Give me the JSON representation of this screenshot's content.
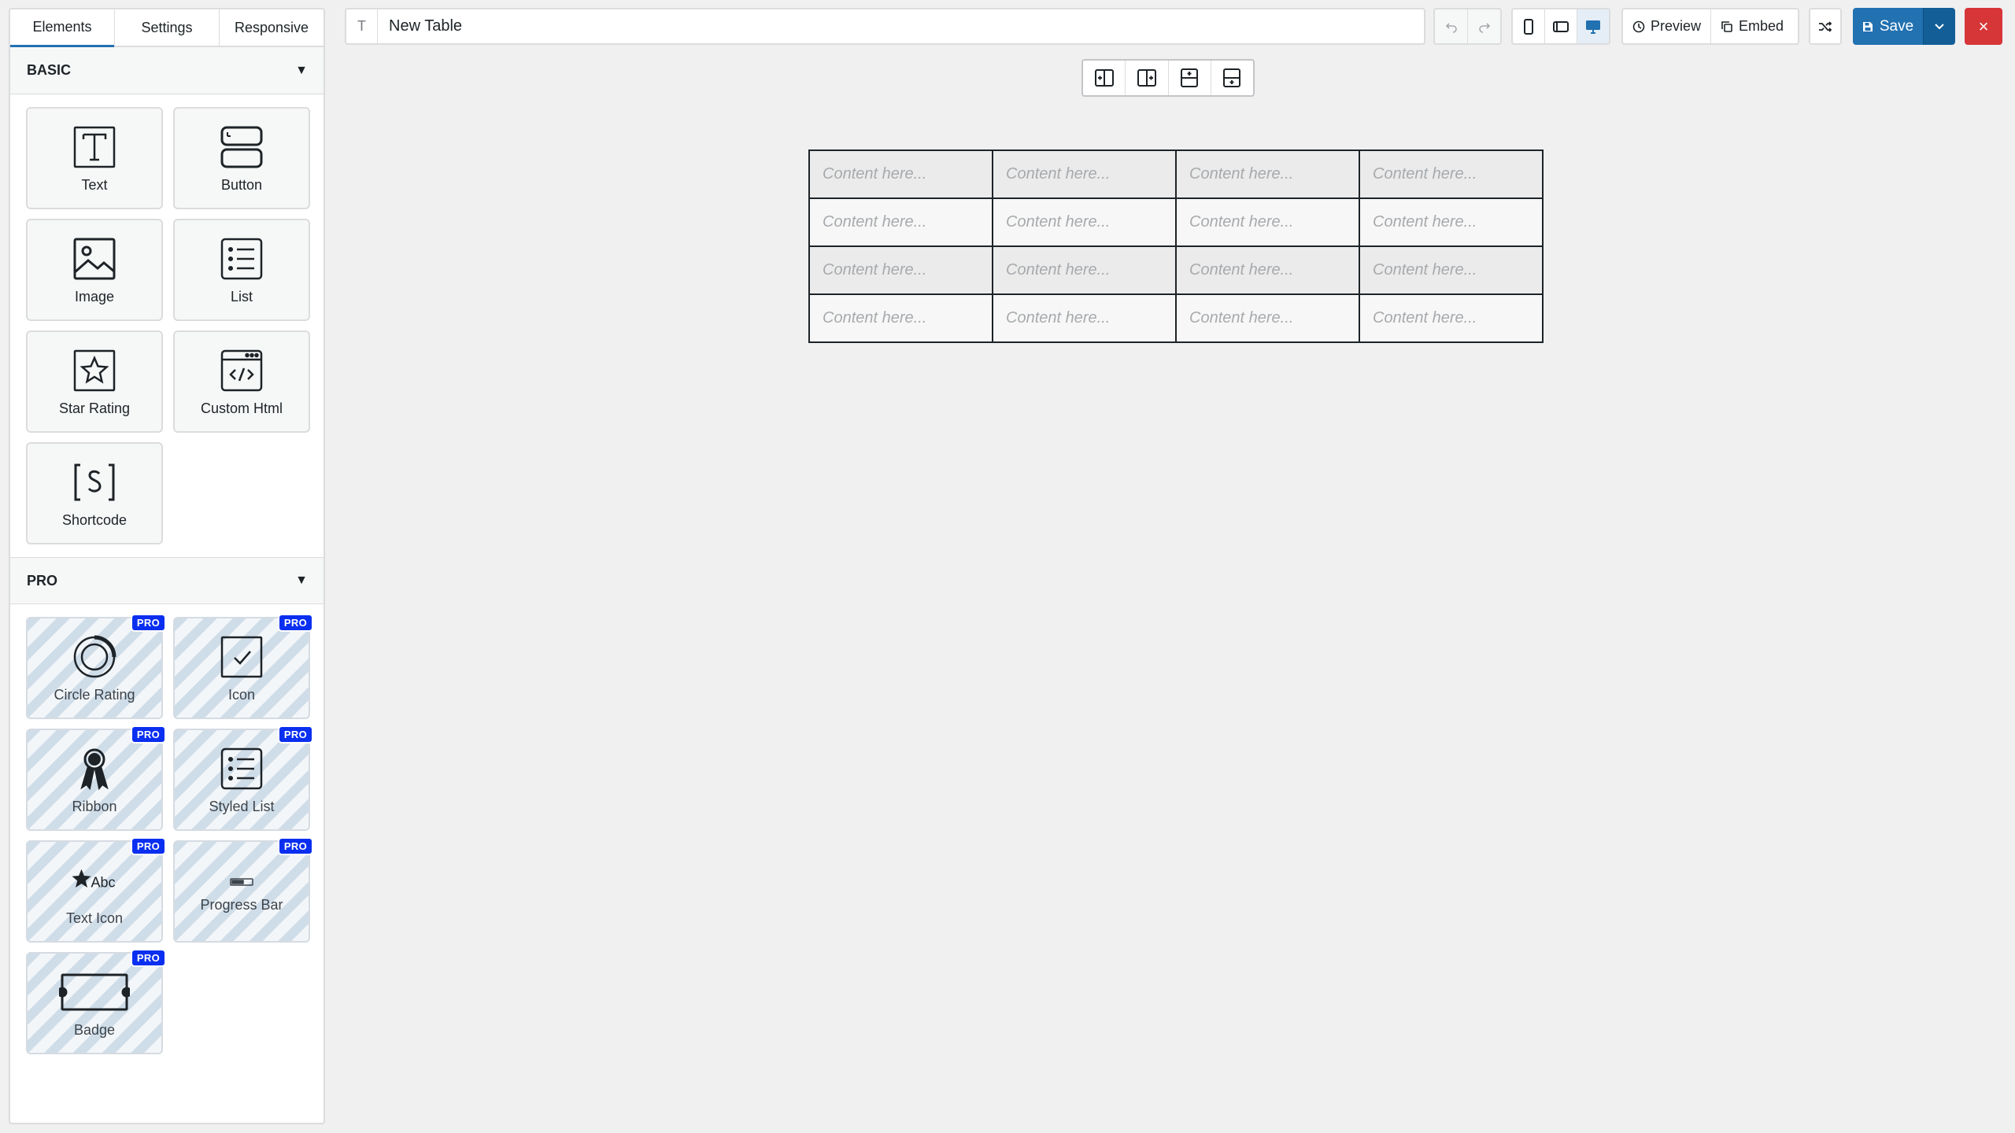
{
  "tabs": [
    "Elements",
    "Settings",
    "Responsive"
  ],
  "sections": {
    "basic": {
      "title": "BASIC",
      "items": [
        "Text",
        "Button",
        "Image",
        "List",
        "Star Rating",
        "Custom Html",
        "Shortcode"
      ]
    },
    "pro": {
      "title": "PRO",
      "badge": "PRO",
      "items": [
        "Circle Rating",
        "Icon",
        "Ribbon",
        "Styled List",
        "Text Icon",
        "Progress Bar",
        "Badge"
      ]
    }
  },
  "toolbar": {
    "title_value": "New Table",
    "title_icon": "T",
    "preview_label": "Preview",
    "embed_label": "Embed",
    "save_label": "Save",
    "close_label": "×"
  },
  "table": {
    "placeholder": "Content here...",
    "rows": [
      [
        "Content here...",
        "Content here...",
        "Content here...",
        "Content here..."
      ],
      [
        "Content here...",
        "Content here...",
        "Content here...",
        "Content here..."
      ],
      [
        "Content here...",
        "Content here...",
        "Content here...",
        "Content here..."
      ],
      [
        "Content here...",
        "Content here...",
        "Content here...",
        "Content here..."
      ]
    ]
  },
  "colors": {
    "accent": "#2271b1",
    "danger": "#d63638",
    "pro_badge": "#0a2ff0"
  }
}
